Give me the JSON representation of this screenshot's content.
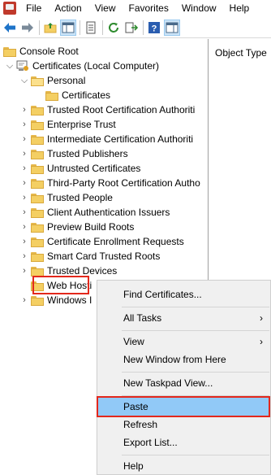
{
  "menubar": {
    "items": [
      "File",
      "Action",
      "View",
      "Favorites",
      "Window",
      "Help"
    ]
  },
  "tree": {
    "console_root": "Console Root",
    "certificates_root": "Certificates (Local Computer)",
    "personal": "Personal",
    "personal_certificates": "Certificates",
    "stores": [
      "Trusted Root Certification Authoriti",
      "Enterprise Trust",
      "Intermediate Certification Authoriti",
      "Trusted Publishers",
      "Untrusted Certificates",
      "Third-Party Root Certification Autho",
      "Trusted People",
      "Client Authentication Issuers",
      "Preview Build Roots",
      "Certificate Enrollment Requests",
      "Smart Card Trusted Roots",
      "Trusted Devices",
      "Web Hosti",
      "Windows I"
    ]
  },
  "right_pane": {
    "column_header": "Object Type"
  },
  "context_menu": {
    "find_certificates": "Find Certificates...",
    "all_tasks": "All Tasks",
    "view": "View",
    "new_window": "New Window from Here",
    "new_taskpad": "New Taskpad View...",
    "paste": "Paste",
    "refresh": "Refresh",
    "export_list": "Export List...",
    "help": "Help",
    "submenu_arrow": "›"
  },
  "colors": {
    "highlight_border": "#e3281c",
    "selected_item": "#91c9f7"
  }
}
